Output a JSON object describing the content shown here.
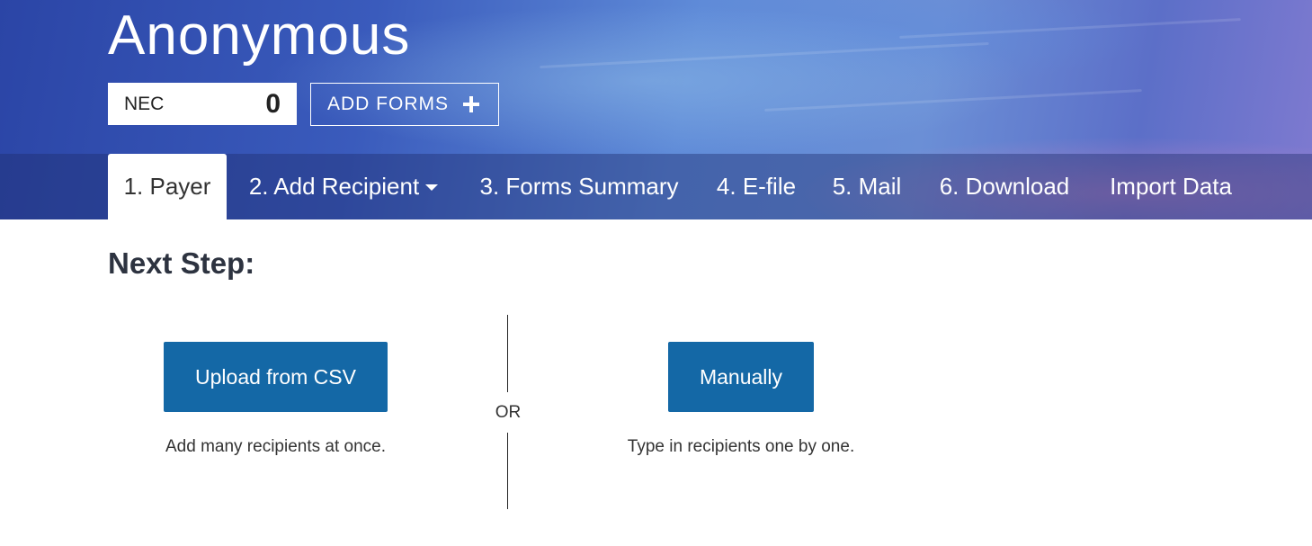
{
  "header": {
    "app_title": "Anonymous",
    "counter": {
      "label": "NEC",
      "value": "0"
    },
    "add_forms_label": "ADD FORMS",
    "add_forms_icon": "plus-icon"
  },
  "tabs": [
    {
      "label": "1. Payer",
      "active": true
    },
    {
      "label": "2. Add Recipient",
      "active": false,
      "has_dropdown": true
    },
    {
      "label": "3. Forms Summary",
      "active": false
    },
    {
      "label": "4. E-file",
      "active": false
    },
    {
      "label": "5. Mail",
      "active": false
    },
    {
      "label": "6. Download",
      "active": false
    },
    {
      "label": "Import Data",
      "active": false
    }
  ],
  "main": {
    "heading": "Next Step:",
    "upload_button": "Upload from CSV",
    "upload_hint": "Add many recipients at once.",
    "or_label": "OR",
    "manual_button": "Manually",
    "manual_hint": "Type in recipients one by one."
  },
  "colors": {
    "primary_button": "#1468a6",
    "header_gradient_start": "#2b45a6",
    "header_gradient_end": "#7f7ad0",
    "text_dark": "#2d3340"
  }
}
